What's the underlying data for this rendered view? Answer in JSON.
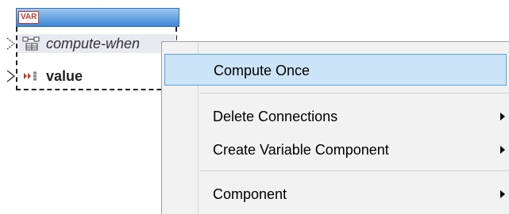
{
  "variable_component": {
    "badge": "VAR",
    "items": [
      {
        "label": "compute-when",
        "icon": "compute-when-icon"
      },
      {
        "label": "value",
        "icon": "value-icon"
      }
    ]
  },
  "context_menu": {
    "items": [
      {
        "label": "Compute Once",
        "has_submenu": false,
        "highlighted": true
      },
      {
        "label": "Delete Connections",
        "has_submenu": true
      },
      {
        "label": "Create Variable Component",
        "has_submenu": true
      },
      {
        "label": "Component",
        "has_submenu": true
      }
    ]
  },
  "colors": {
    "header_top": "#9fc8f0",
    "header_bottom": "#3d88d8",
    "badge_red": "#c0392b",
    "menu_highlight": "#cce4f7",
    "menu_highlight_border": "#5aa0e0",
    "menu_background": "#f2f2f2"
  }
}
